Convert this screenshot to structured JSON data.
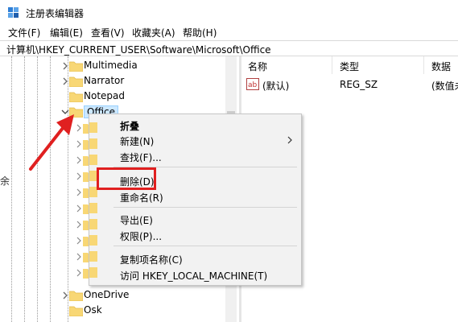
{
  "window": {
    "title": "注册表编辑器"
  },
  "menu": {
    "file": "文件(F)",
    "edit": "编辑(E)",
    "view": "查看(V)",
    "favorites": "收藏夹(A)",
    "help": "帮助(H)"
  },
  "address": {
    "path": "计算机\\HKEY_CURRENT_USER\\Software\\Microsoft\\Office"
  },
  "tree": {
    "items": [
      {
        "label": "Multimedia"
      },
      {
        "label": "Narrator"
      },
      {
        "label": "Notepad"
      },
      {
        "label": "Office"
      },
      {
        "label": "OneDrive"
      },
      {
        "label": "Osk"
      }
    ],
    "edge_fragment": "余"
  },
  "values_pane": {
    "columns": {
      "name": "名称",
      "type": "类型",
      "data": "数据"
    },
    "rows": [
      {
        "name": "(默认)",
        "type": "REG_SZ",
        "data": "(数值未"
      }
    ]
  },
  "context_menu": {
    "collapse": "折叠",
    "new": "新建(N)",
    "find": "查找(F)...",
    "delete": "删除(D)",
    "rename": "重命名(R)",
    "export": "导出(E)",
    "permissions": "权限(P)...",
    "copy_key_name": "复制项名称(C)",
    "visit": "访问 HKEY_LOCAL_MACHINE(T)"
  },
  "colors": {
    "highlight": "#e02020",
    "selection": "#cce8ff",
    "folder": "#f8d775"
  },
  "icons": {
    "app": "registry-editor-icon",
    "folder": "folder-icon",
    "value": "string-value-ab-icon",
    "submenu": "chevron-right-icon"
  }
}
